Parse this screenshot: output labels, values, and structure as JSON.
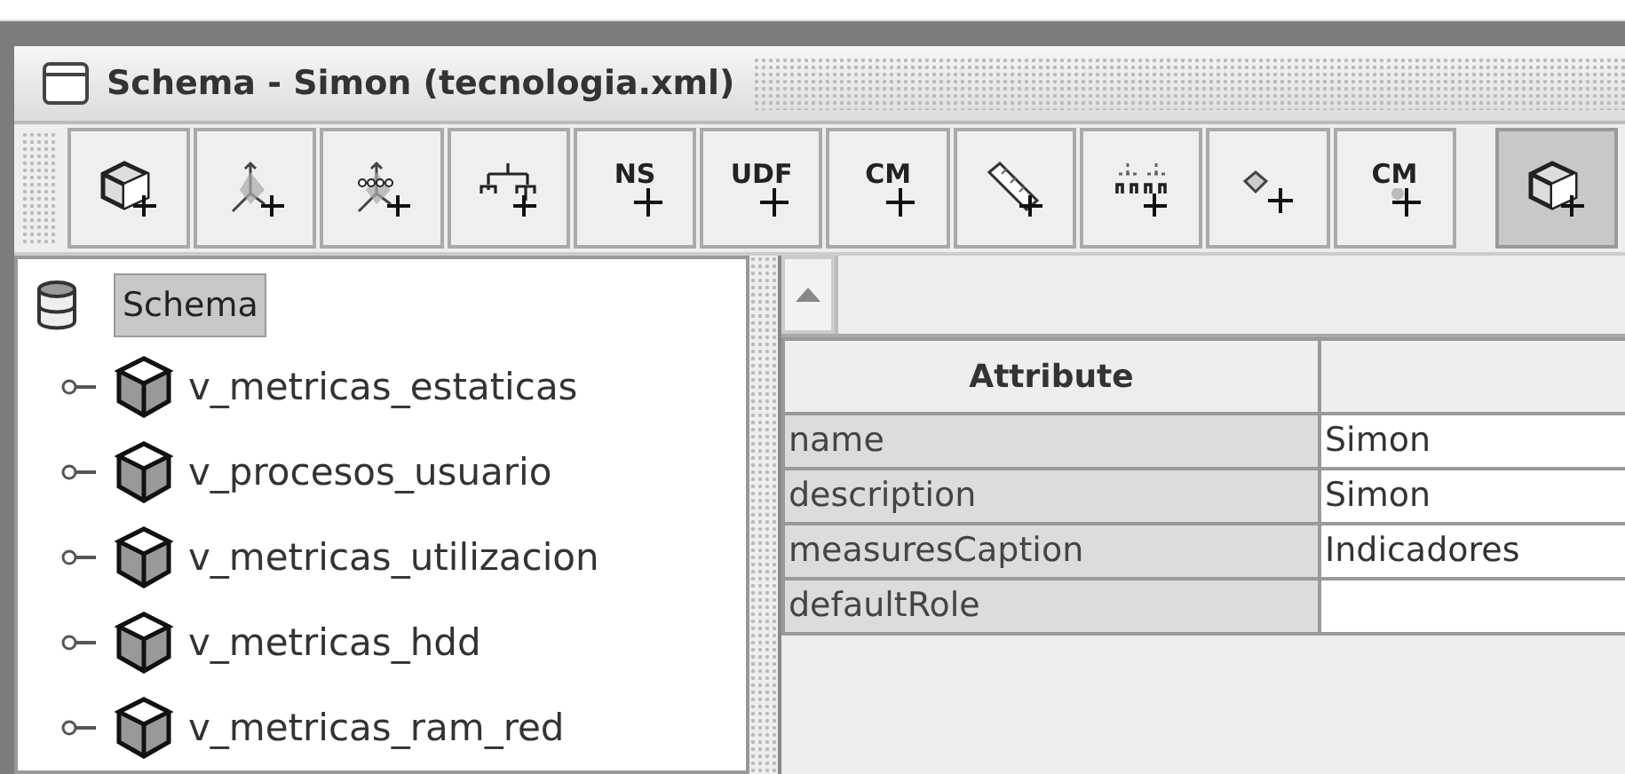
{
  "window": {
    "title": "Schema - Simon (tecnologia.xml)"
  },
  "toolbar": [
    {
      "kind": "cube",
      "selected": false
    },
    {
      "kind": "axes",
      "selected": false
    },
    {
      "kind": "axes-dots",
      "selected": false
    },
    {
      "kind": "hierarchy",
      "selected": false
    },
    {
      "kind": "text",
      "label": "NS",
      "selected": false
    },
    {
      "kind": "text",
      "label": "UDF",
      "selected": false
    },
    {
      "kind": "text",
      "label": "CM",
      "selected": false
    },
    {
      "kind": "ruler",
      "selected": false
    },
    {
      "kind": "levels",
      "selected": false
    },
    {
      "kind": "diamond",
      "selected": false
    },
    {
      "kind": "text-diamond",
      "label": "CM",
      "selected": false
    },
    {
      "kind": "cube",
      "selected": true
    }
  ],
  "tree": {
    "root": {
      "label": "Schema",
      "selected": true
    },
    "items": [
      {
        "label": "v_metricas_estaticas"
      },
      {
        "label": "v_procesos_usuario"
      },
      {
        "label": "v_metricas_utilizacion"
      },
      {
        "label": "v_metricas_hdd"
      },
      {
        "label": "v_metricas_ram_red"
      }
    ]
  },
  "table": {
    "columns": [
      "Attribute"
    ],
    "rows": [
      {
        "attribute": "name",
        "value": "Simon"
      },
      {
        "attribute": "description",
        "value": "Simon"
      },
      {
        "attribute": "measuresCaption",
        "value": "Indicadores"
      },
      {
        "attribute": "defaultRole"
      }
    ]
  }
}
